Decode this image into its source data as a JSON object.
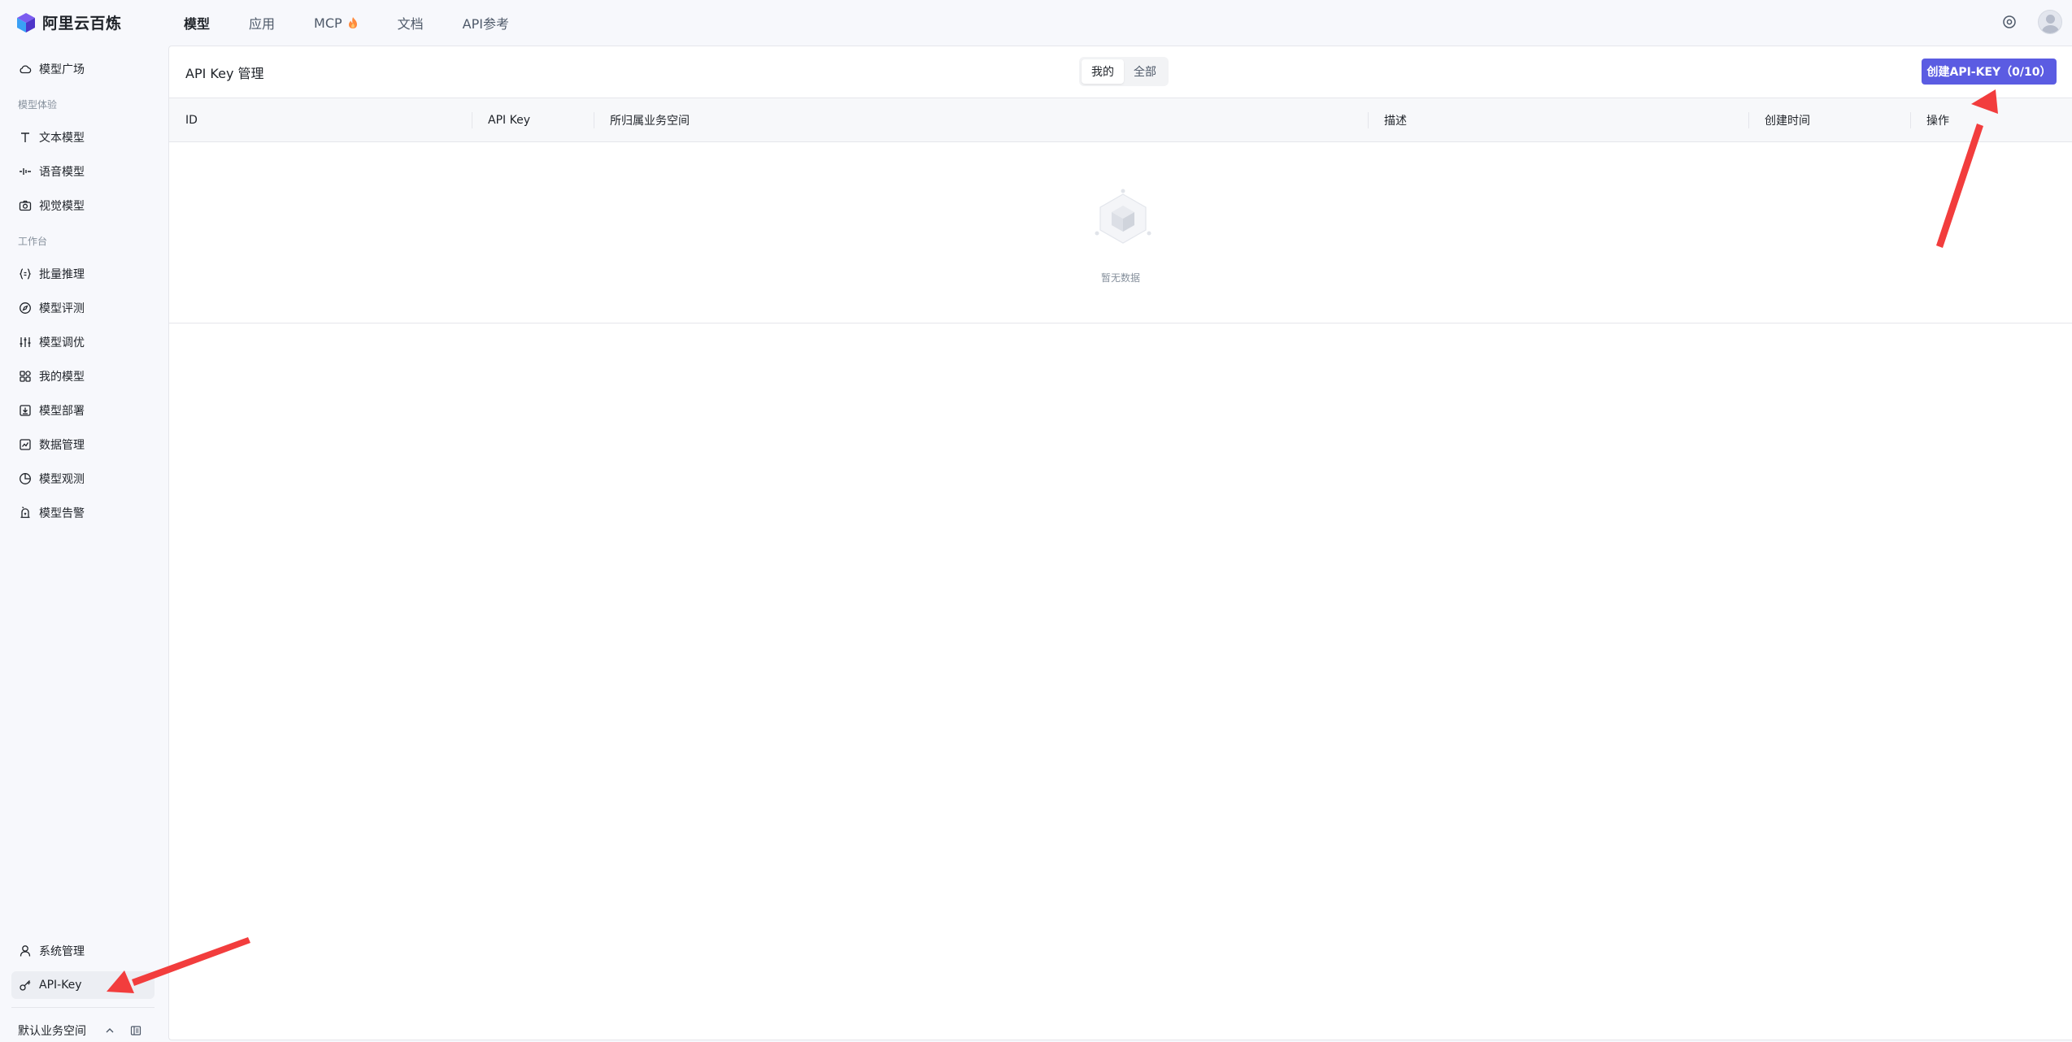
{
  "brand": {
    "name": "阿里云百炼"
  },
  "nav": [
    {
      "label": "模型",
      "active": true
    },
    {
      "label": "应用",
      "active": false
    },
    {
      "label": "MCP",
      "active": false,
      "icon": "fire-icon"
    },
    {
      "label": "文档",
      "active": false
    },
    {
      "label": "API参考",
      "active": false
    }
  ],
  "sidebar": {
    "top_item": {
      "label": "模型广场",
      "icon": "cloud-icon"
    },
    "section_experience": "模型体验",
    "experience_items": [
      {
        "label": "文本模型",
        "icon": "text-icon"
      },
      {
        "label": "语音模型",
        "icon": "voice-icon"
      },
      {
        "label": "视觉模型",
        "icon": "camera-icon"
      }
    ],
    "section_workbench": "工作台",
    "workbench_items": [
      {
        "label": "批量推理",
        "icon": "braces-icon"
      },
      {
        "label": "模型评测",
        "icon": "compass-icon"
      },
      {
        "label": "模型调优",
        "icon": "sliders-icon"
      },
      {
        "label": "我的模型",
        "icon": "apps-icon"
      },
      {
        "label": "模型部署",
        "icon": "deploy-icon"
      },
      {
        "label": "数据管理",
        "icon": "chart-icon"
      },
      {
        "label": "模型观测",
        "icon": "pie-icon"
      },
      {
        "label": "模型告警",
        "icon": "alarm-icon"
      }
    ],
    "bottom_items": [
      {
        "label": "系统管理",
        "icon": "user-icon"
      },
      {
        "label": "API-Key",
        "icon": "key-icon",
        "active": true
      }
    ],
    "workspace": "默认业务空间"
  },
  "main": {
    "title": "API Key 管理",
    "scope_tabs": [
      {
        "label": "我的",
        "active": true
      },
      {
        "label": "全部",
        "active": false
      }
    ],
    "create_button": "创建API-KEY（0/10）",
    "columns": [
      "ID",
      "API Key",
      "所归属业务空间",
      "描述",
      "创建时间",
      "操作"
    ],
    "empty_text": "暂无数据"
  },
  "colors": {
    "accent": "#5b5ce2",
    "annotation_arrow": "#f23d3d"
  }
}
